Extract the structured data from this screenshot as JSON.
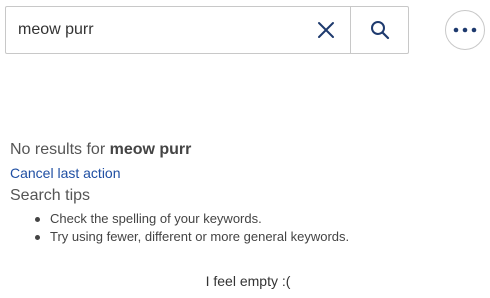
{
  "search": {
    "value": "meow purr",
    "placeholder": ""
  },
  "icons": {
    "clear": "close-icon",
    "search": "search-icon",
    "more": "more-horizontal-icon"
  },
  "results": {
    "prefix": "No results for ",
    "query": "meow purr",
    "cancel_link": "Cancel last action"
  },
  "tips": {
    "heading": "Search tips",
    "items": [
      "Check the spelling of your keywords.",
      "Try using fewer, different or more general keywords."
    ]
  },
  "footer": {
    "message": "I feel empty :("
  },
  "colors": {
    "link": "#1f4fa3",
    "icon": "#1e3a6e",
    "border": "#c8c8c8"
  }
}
